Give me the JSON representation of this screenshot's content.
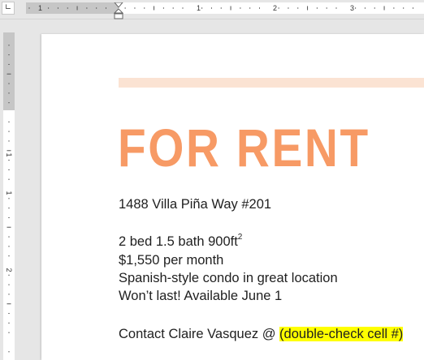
{
  "ruler": {
    "tab_selector_glyph": "∟",
    "horizontal_numbers": [
      "1",
      "1",
      "2",
      "3"
    ],
    "vertical_numbers": [
      "1",
      "1",
      "2"
    ]
  },
  "document": {
    "accent_color": "#fbe3d3",
    "headline": "FOR RENT",
    "headline_color": "#f79a65",
    "address": "1488 Villa Piña Way #201",
    "details_main": "2 bed 1.5 bath 900ft",
    "details_superscript": "2",
    "price": "$1,550 per month",
    "description": "Spanish-style condo in great location",
    "availability": "Won’t last! Available June 1",
    "contact_prefix": "Contact Claire Vasquez @ ",
    "contact_highlighted": "(double-check cell #)",
    "highlight_color": "#ffff00"
  }
}
